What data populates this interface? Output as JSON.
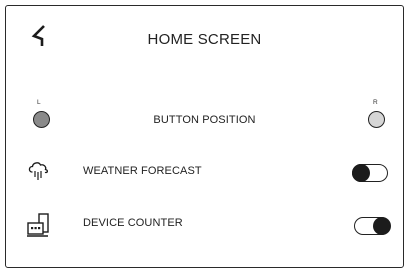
{
  "header": {
    "title": "HOME SCREEN",
    "back_icon": "back-arrow-icon"
  },
  "button_position": {
    "label": "BUTTON POSITION",
    "left_label": "L",
    "right_label": "R",
    "selected": "L",
    "left_color": "#8a8a8a",
    "right_color": "#d6d6d6"
  },
  "settings": [
    {
      "label": "WEATNER FORECAST",
      "icon": "weather-cloud-rain-icon",
      "toggle_on": false
    },
    {
      "label": "DEVICE COUNTER",
      "icon": "device-counter-icon",
      "toggle_on": true
    }
  ]
}
